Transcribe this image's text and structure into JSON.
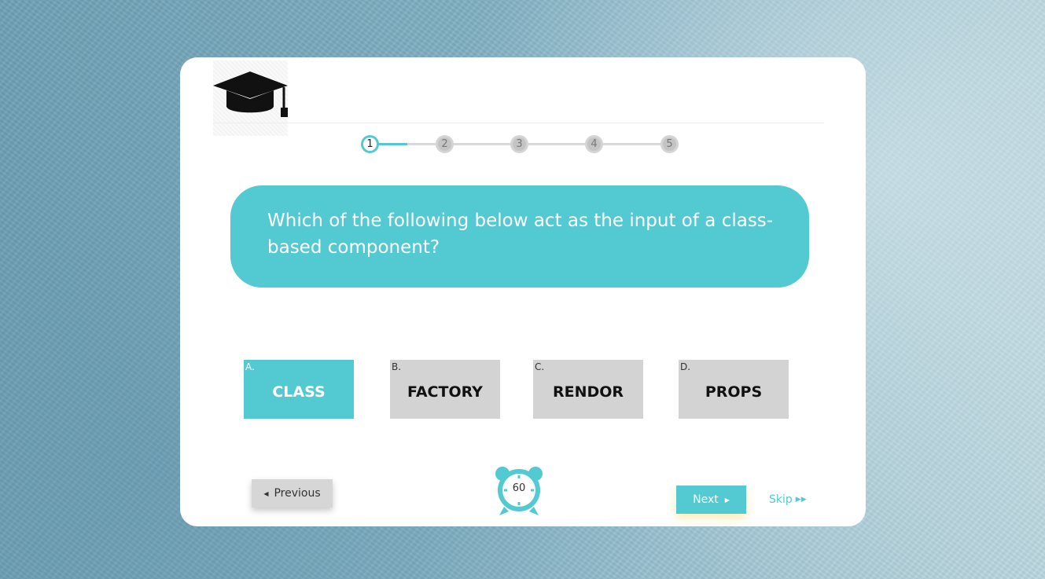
{
  "logo": {
    "icon": "graduation-cap-icon"
  },
  "stepper": {
    "current": 1,
    "steps": [
      "1",
      "2",
      "3",
      "4",
      "5"
    ]
  },
  "question": {
    "text": "Which of the following below act as the input of a class-based component?"
  },
  "options": [
    {
      "letter": "A.",
      "label": "CLASS",
      "selected": true
    },
    {
      "letter": "B.",
      "label": "FACTORY",
      "selected": false
    },
    {
      "letter": "C.",
      "label": "RENDOR",
      "selected": false
    },
    {
      "letter": "D.",
      "label": "PROPS",
      "selected": false
    }
  ],
  "navigation": {
    "previous_label": "Previous",
    "next_label": "Next",
    "skip_label": "Skip",
    "previous_icon": "caret-left-icon",
    "next_icon": "caret-right-icon",
    "skip_icon": "fast-forward-icon"
  },
  "timer": {
    "icon": "alarm-clock-icon",
    "value": "60"
  },
  "colors": {
    "accent": "#53c9d2",
    "option_default": "#d3d3d3",
    "button_gray": "#d6d6d6"
  }
}
